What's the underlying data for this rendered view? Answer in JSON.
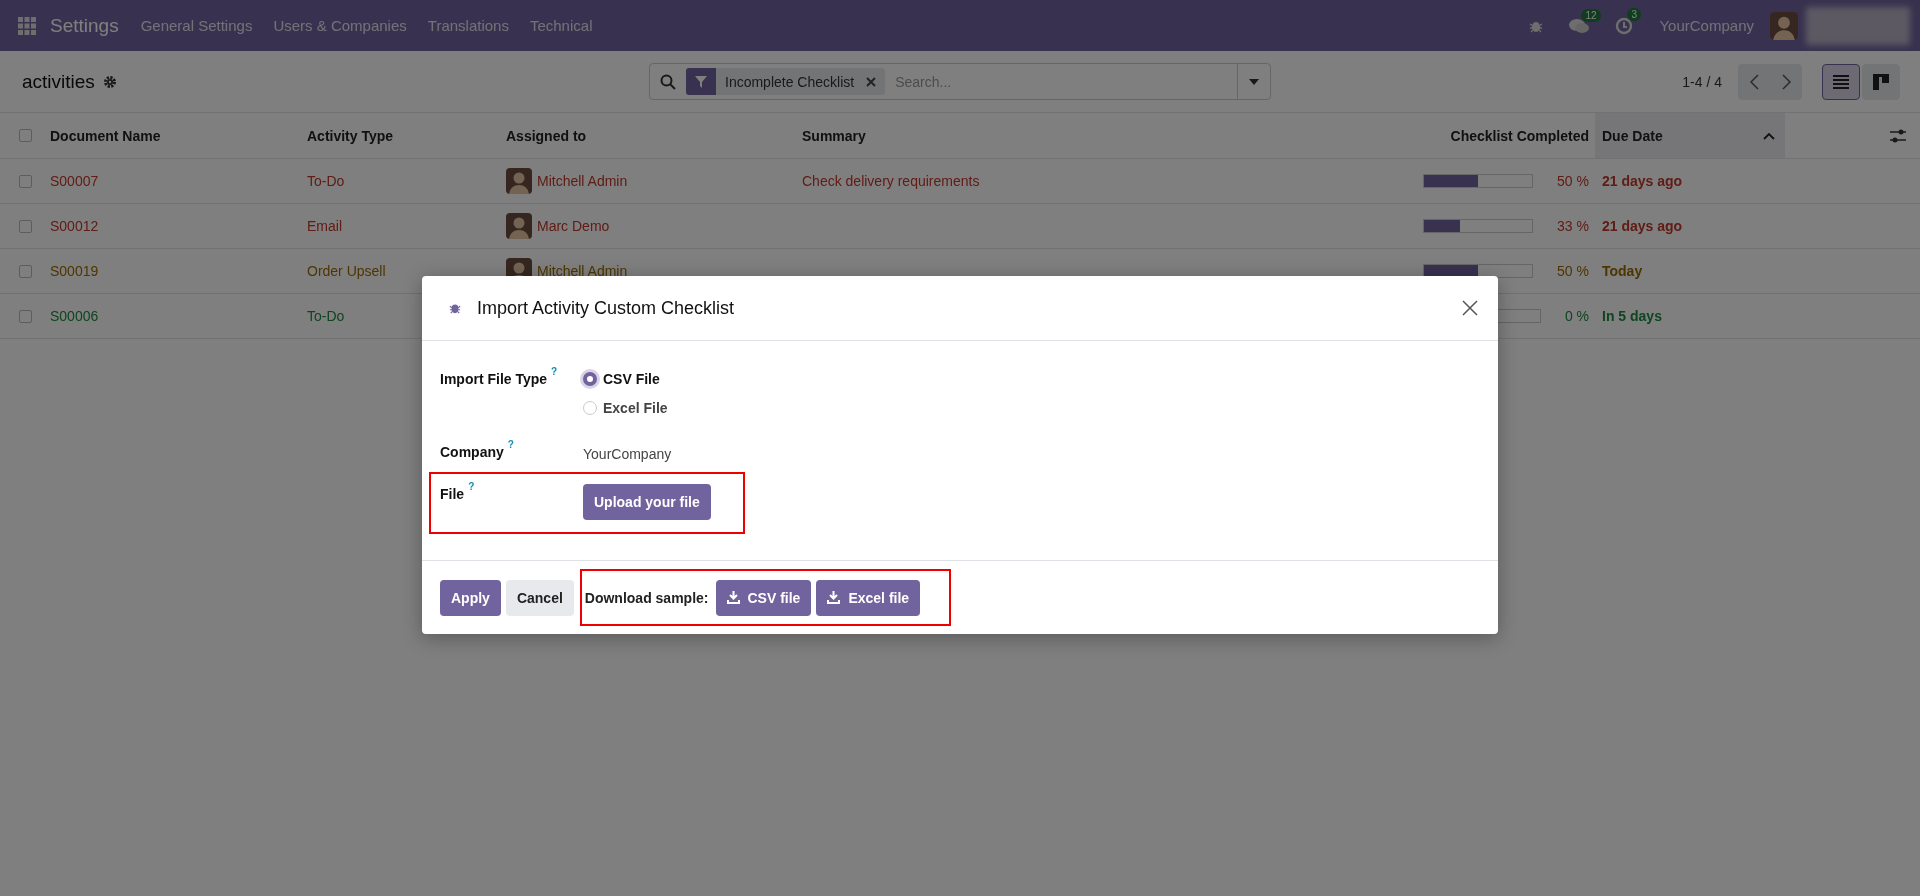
{
  "navbar": {
    "app": "Settings",
    "menus": [
      "General Settings",
      "Users & Companies",
      "Translations",
      "Technical"
    ],
    "messages_count": "12",
    "activities_count": "3",
    "company": "YourCompany"
  },
  "control_panel": {
    "title": "activities",
    "facet": "Incomplete Checklist",
    "search_placeholder": "Search...",
    "pager": "1-4 / 4",
    "views": [
      {
        "kind": "list",
        "selected": true
      },
      {
        "kind": "kanban",
        "selected": false
      }
    ]
  },
  "table": {
    "all_checked": false,
    "columns": [
      {
        "label": "Document Name",
        "sorted": false
      },
      {
        "label": "Activity Type",
        "sorted": false
      },
      {
        "label": "Assigned to",
        "sorted": false
      },
      {
        "label": "Summary",
        "sorted": false
      },
      {
        "label": "Checklist Completed",
        "sorted": false
      },
      {
        "label": "Due Date",
        "sorted": true
      }
    ],
    "rows": [
      {
        "document": "S00007",
        "activity_type": "To-Do",
        "assignee": "Mitchell Admin",
        "summary": "Check delivery requirements",
        "level": 0.5,
        "percent": "50 %",
        "due": "21 days ago",
        "kind": "overdue",
        "checked": false
      },
      {
        "document": "S00012",
        "activity_type": "Email",
        "assignee": "Marc Demo",
        "level": 0.33,
        "percent": "33 %",
        "due": "21 days ago",
        "kind": "overdue",
        "checked": false
      },
      {
        "document": "S00019",
        "activity_type": "Order Upsell",
        "assignee": "Mitchell Admin",
        "level": 0.5,
        "percent": "50 %",
        "due": "Today",
        "kind": "today",
        "checked": false
      },
      {
        "document": "S00006",
        "activity_type": "To-Do",
        "level": 0,
        "percent": "0 %",
        "due": "In 5 days",
        "kind": "planned",
        "checked": false
      }
    ]
  },
  "dialog": {
    "title": "Import Activity Custom Checklist",
    "fields": [
      {
        "kind": "radio",
        "label": "Import File Type",
        "help": "?",
        "options": [
          {
            "label": "CSV File",
            "selected": true
          },
          {
            "label": "Excel File",
            "selected": false
          }
        ]
      },
      {
        "kind": "text",
        "label": "Company",
        "help": "?",
        "value": "YourCompany"
      },
      {
        "kind": "upload",
        "label": "File",
        "help": "?",
        "button": "Upload your file",
        "highlighted": true
      }
    ],
    "buttons": [
      {
        "label": "Apply",
        "kind": "primary"
      },
      {
        "label": "Cancel",
        "kind": "secondary"
      }
    ],
    "download": {
      "label": "Download sample:",
      "buttons": [
        "CSV file",
        "Excel file"
      ],
      "highlighted": true
    }
  }
}
